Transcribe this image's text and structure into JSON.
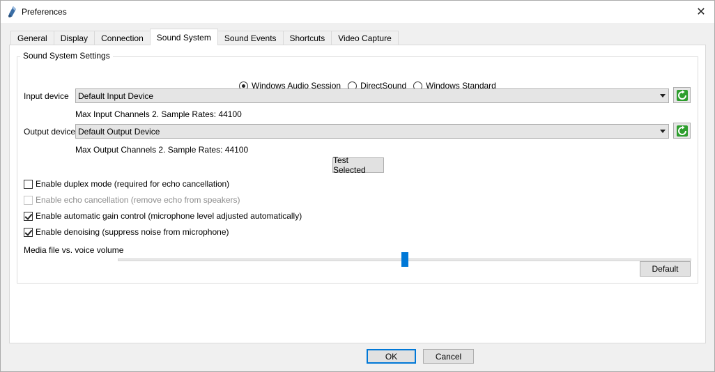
{
  "window": {
    "title": "Preferences",
    "close_glyph": "✕"
  },
  "tabs": [
    {
      "label": "General",
      "active": false
    },
    {
      "label": "Display",
      "active": false
    },
    {
      "label": "Connection",
      "active": false
    },
    {
      "label": "Sound System",
      "active": true
    },
    {
      "label": "Sound Events",
      "active": false
    },
    {
      "label": "Shortcuts",
      "active": false
    },
    {
      "label": "Video Capture",
      "active": false
    }
  ],
  "sound": {
    "group_title": "Sound System Settings",
    "radios": [
      {
        "label": "Windows Audio Session",
        "checked": true
      },
      {
        "label": "DirectSound",
        "checked": false
      },
      {
        "label": "Windows Standard",
        "checked": false
      }
    ],
    "input_label": "Input device",
    "input_value": "Default Input Device",
    "input_info": "Max Input Channels 2. Sample Rates: 44100",
    "output_label": "Output device",
    "output_value": "Default Output Device",
    "output_info": "Max Output Channels 2. Sample Rates: 44100",
    "test_button": "Test Selected",
    "checks": [
      {
        "label": "Enable duplex mode (required for echo cancellation)",
        "checked": false,
        "enabled": true
      },
      {
        "label": "Enable echo cancellation (remove echo from speakers)",
        "checked": false,
        "enabled": false
      },
      {
        "label": "Enable automatic gain control (microphone level adjusted automatically)",
        "checked": true,
        "enabled": true
      },
      {
        "label": "Enable denoising (suppress noise from microphone)",
        "checked": true,
        "enabled": true
      }
    ],
    "volume_label": "Media file vs. voice volume",
    "volume_level": 0.5,
    "default_button": "Default"
  },
  "footer": {
    "ok": "OK",
    "cancel": "Cancel"
  },
  "colors": {
    "accent": "#0078d7",
    "refresh_green": "#2e9e2e"
  }
}
